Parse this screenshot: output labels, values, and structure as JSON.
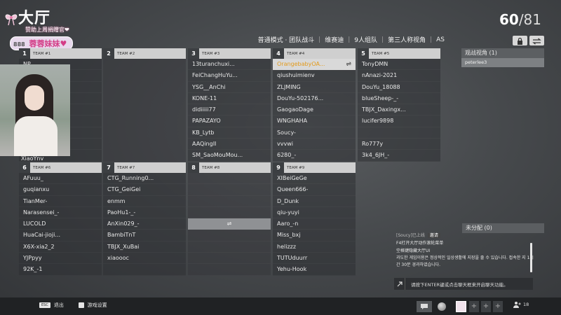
{
  "title": "大厅",
  "overlay": {
    "subtext": "赞助上周捐赠官❤",
    "badge_num": "888",
    "badge_text": "蓉蓉妹妹♥"
  },
  "players_count": {
    "current": "60",
    "max": "/81"
  },
  "mode_bar": [
    "普通模式 · 团队战斗",
    "维赛迪",
    "9人组队",
    "第三人称视角",
    "AS"
  ],
  "teams": [
    {
      "num": "1",
      "label": "TEAM #1",
      "players": [
        "NP",
        "",
        "",
        "",
        "",
        "",
        "",
        "",
        "",
        "",
        "XiaoYnv"
      ]
    },
    {
      "num": "2",
      "label": "TEAM #2",
      "players": []
    },
    {
      "num": "3",
      "label": "TEAM #3",
      "players": [
        "13turanchuxi...",
        "FeiChangHuYu...",
        "YSG__AnChi",
        "KONE-11",
        "didiiiii77",
        "PAPAZAYO",
        "KB_Lytb",
        "AAQingII",
        "SM_SaoMouMou..."
      ]
    },
    {
      "num": "4",
      "label": "TEAM #4",
      "players": [
        "OrangebabyOA...",
        "qiushuimienv",
        "ZLJMING",
        "DouYu-502176...",
        "GaogaoDage",
        "WNGHAHA",
        "Soucy-",
        "vvvwi",
        "6280_-"
      ]
    },
    {
      "num": "5",
      "label": "TEAM #5",
      "players": [
        "TonyDMN",
        "nAnazi-2021",
        "DouYu_18088",
        "blueSheep-_-",
        "TBJX_Daxingx...",
        "lucifer9898",
        "",
        "Ro777y",
        "3k4_6JH_-"
      ]
    },
    {
      "num": "6",
      "label": "TEAM #6",
      "players": [
        "AFuuu_",
        "guqianxu",
        "TianMer-",
        "Narasensei_-",
        "LUCOLD",
        "HuaCai-jioji...",
        "X6X-xia2_2",
        "YJPpyy",
        "92K_-1"
      ]
    },
    {
      "num": "7",
      "label": "TEAM #7",
      "players": [
        "CTG_Running0...",
        "CTG_GeiGei",
        "enmm",
        "PaoHu1-_-",
        "AnXin029_-",
        "BambiTnT",
        "TBJX_XuBai",
        "xiaoooc"
      ]
    },
    {
      "num": "8",
      "label": "TEAM #8",
      "players": []
    },
    {
      "num": "9",
      "label": "TEAM #9",
      "players": [
        "XIBeiGeGe",
        "Queen666-",
        "D_Dunk",
        "qiu-yuyi",
        "Aaro_-n",
        "Miss_bxj",
        "helizzz",
        "TUTUduurr",
        "Yehu-Hook"
      ]
    }
  ],
  "swap_glyph": "⇌",
  "spectator": {
    "title": "观战视角 (1)",
    "members": [
      "peterlee3"
    ]
  },
  "unassigned": {
    "title": "未分配 (0)"
  },
  "chat": {
    "first_line": "[Soucy]已上线",
    "first_tag": "邀请",
    "lines": [
      "F4打开大厅动作滚轮菜单",
      "空格键隐藏大厅UI",
      "과도한 게임이용은 정상적인 일상생활에 지장을 줄 수 있습니다. 접속한 지 1시간 30분 경과하였습니다."
    ],
    "input_placeholder": "请按下ENTER键或点击聊天框来开启聊天功能。",
    "input_icon": "ENTER"
  },
  "bottom": {
    "exit_key": "ESC",
    "exit_label": "退出",
    "settings_label": "游戏设置",
    "friends_count": "18"
  }
}
